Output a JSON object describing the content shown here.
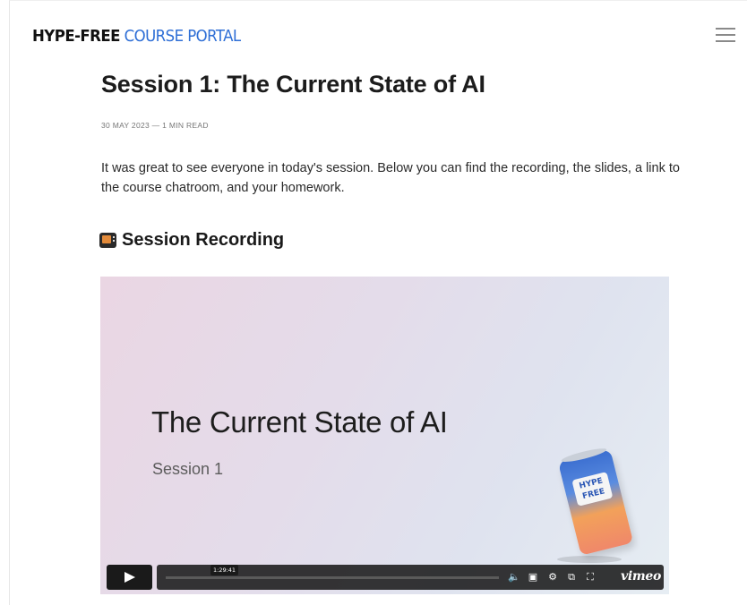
{
  "header": {
    "brand_bold": "HYPE-FREE",
    "brand_light": "COURSE PORTAL",
    "menu_icon": "hamburger-menu-icon"
  },
  "article": {
    "title": "Session 1: The Current State of AI",
    "meta": "30 MAY 2023 — 1 MIN READ",
    "intro": "It was great to see everyone in today's session. Below you can find the recording, the slides, a link to the course chatroom, and your homework.",
    "section_heading": "Session Recording",
    "section_icon": "television-icon"
  },
  "video": {
    "slide_title": "The Current State of AI",
    "slide_subtitle": "Session 1",
    "can_label": "HYPE FREE",
    "duration": "1:29:41",
    "brand": "vimeo",
    "icons": [
      "play-icon",
      "volume-icon",
      "captions-icon",
      "settings-icon",
      "pip-icon",
      "fullscreen-icon"
    ]
  }
}
